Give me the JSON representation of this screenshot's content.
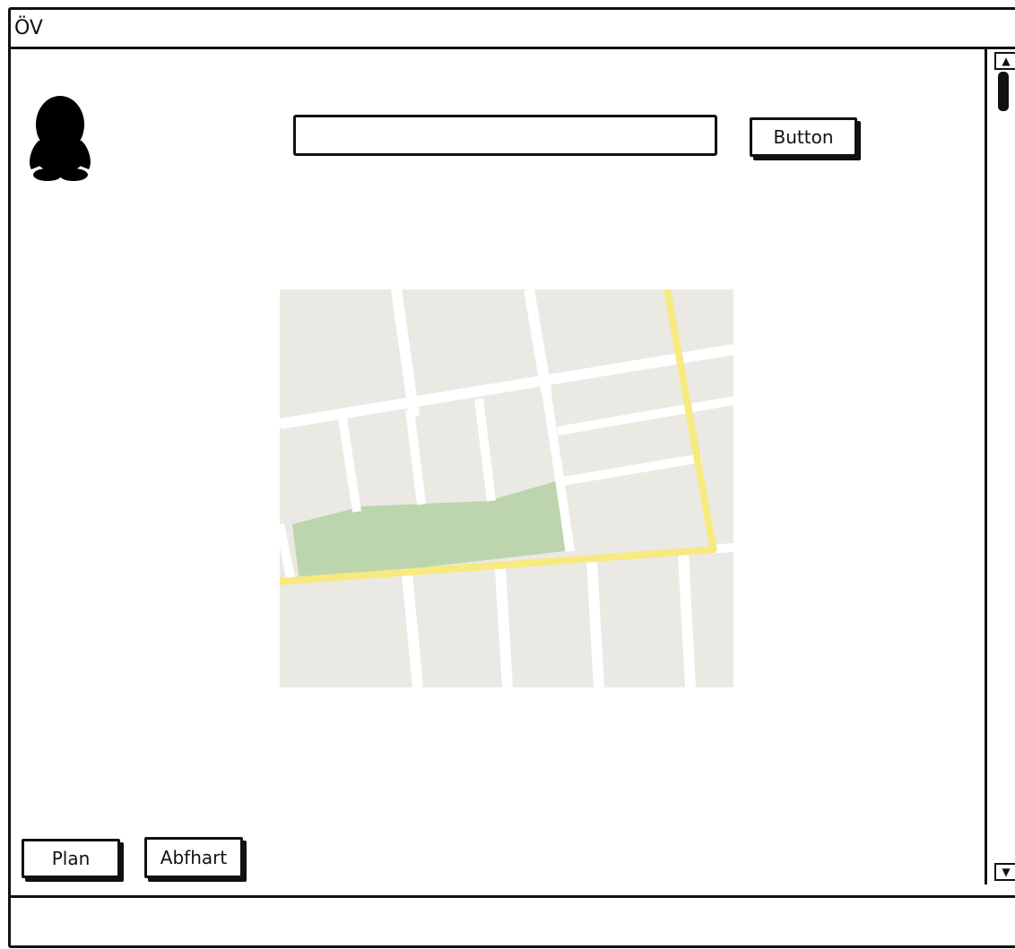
{
  "window": {
    "title": "ÖV"
  },
  "header": {
    "avatar_icon": "penguin-silhouette-icon",
    "search": {
      "value": "",
      "placeholder": ""
    },
    "button_label": "Button"
  },
  "map": {
    "colors": {
      "land": "#ebe9e4",
      "road": "#ffffff",
      "major_road": "#f6ea80",
      "park": "#bdd5ad"
    }
  },
  "footer": {
    "plan_label": "Plan",
    "abfahrt_label": "Abfhart"
  },
  "scrollbar": {
    "up_icon": "scroll-up-arrow-icon",
    "down_icon": "scroll-down-arrow-icon"
  }
}
